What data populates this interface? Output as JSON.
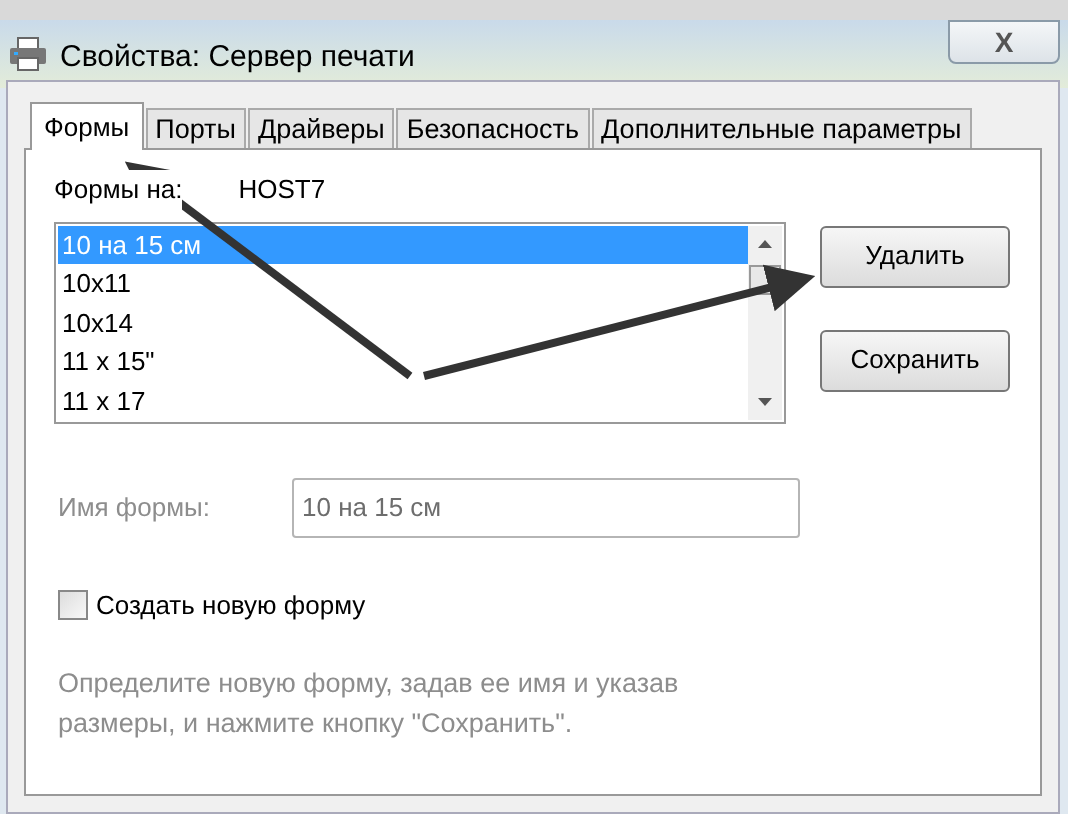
{
  "window": {
    "title": "Свойства: Сервер печати",
    "close": "X"
  },
  "tabs": [
    {
      "label": "Формы",
      "selected": true
    },
    {
      "label": "Порты",
      "selected": false
    },
    {
      "label": "Драйверы",
      "selected": false
    },
    {
      "label": "Безопасность",
      "selected": false
    },
    {
      "label": "Дополнительные параметры",
      "selected": false
    }
  ],
  "forms_on": {
    "label": "Формы на:",
    "value": "HOST7"
  },
  "forms_list": [
    {
      "label": "10 на 15 см",
      "selected": true
    },
    {
      "label": "10x11",
      "selected": false
    },
    {
      "label": "10x14",
      "selected": false
    },
    {
      "label": "11 x 15\"",
      "selected": false
    },
    {
      "label": "11 x 17",
      "selected": false
    }
  ],
  "buttons": [
    "Удалить",
    "Сохранить"
  ],
  "form_name": {
    "label": "Имя формы:",
    "value": "10 на 15 см",
    "disabled": true
  },
  "create_new_form": {
    "label": "Создать новую форму",
    "checked": false
  },
  "description": {
    "text": "Определите новую форму, задав ее имя и указав размеры, и нажмите кнопку \"Сохранить\".",
    "disabled": true
  }
}
